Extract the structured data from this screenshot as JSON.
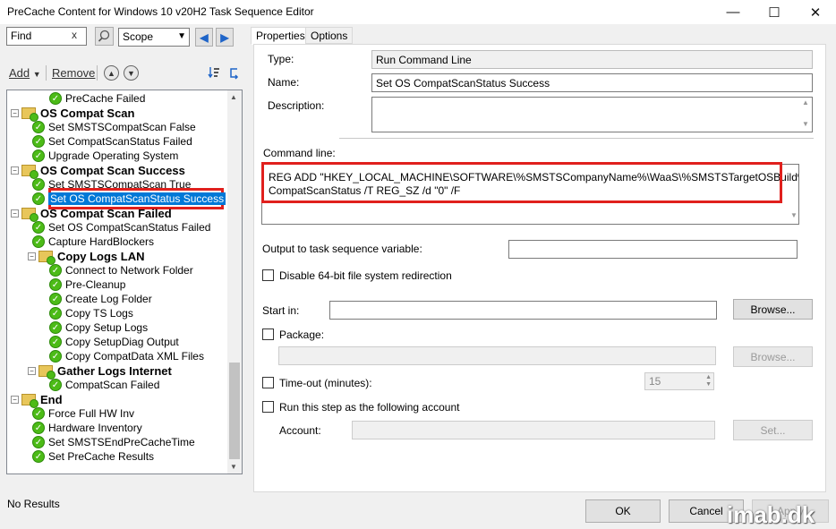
{
  "window": {
    "title": "PreCache Content for Windows 10 v20H2 Task Sequence Editor",
    "minimize_glyph": "—",
    "maximize_glyph": "☐",
    "close_glyph": "✕"
  },
  "toolbar": {
    "find_value": "Find",
    "find_clear": "x",
    "scope_value": "Scope",
    "add_label": "Add",
    "remove_label": "Remove",
    "icons": [
      "search-icon",
      "arrow-left-icon",
      "arrow-right-icon",
      "move-up-icon",
      "move-down-icon",
      "sort-icon",
      "refresh-icon"
    ]
  },
  "tree": {
    "items": [
      {
        "label": "PreCache Failed",
        "type": "step"
      },
      {
        "label": "OS Compat Scan",
        "type": "group"
      },
      {
        "label": "Set SMSTSCompatScan False",
        "type": "step"
      },
      {
        "label": "Set CompatScanStatus Failed",
        "type": "step"
      },
      {
        "label": "Upgrade Operating System",
        "type": "step"
      },
      {
        "label": "OS Compat Scan Success",
        "type": "group"
      },
      {
        "label": "Set SMSTSCompatScan True",
        "type": "step"
      },
      {
        "label": "Set OS CompatScanStatus Success",
        "type": "step",
        "selected": true
      },
      {
        "label": "OS Compat Scan Failed",
        "type": "group"
      },
      {
        "label": "Set OS CompatScanStatus Failed",
        "type": "step"
      },
      {
        "label": "Capture HardBlockers",
        "type": "step"
      },
      {
        "label": "Copy Logs LAN",
        "type": "group"
      },
      {
        "label": "Connect to Network Folder",
        "type": "step"
      },
      {
        "label": "Pre-Cleanup",
        "type": "step"
      },
      {
        "label": "Create Log Folder",
        "type": "step"
      },
      {
        "label": "Copy TS Logs",
        "type": "step"
      },
      {
        "label": "Copy Setup Logs",
        "type": "step"
      },
      {
        "label": "Copy SetupDiag Output",
        "type": "step"
      },
      {
        "label": "Copy CompatData XML Files",
        "type": "step"
      },
      {
        "label": "Gather Logs Internet",
        "type": "group"
      },
      {
        "label": "CompatScan Failed",
        "type": "step"
      },
      {
        "label": "End",
        "type": "group"
      },
      {
        "label": "Force Full HW Inv",
        "type": "step"
      },
      {
        "label": "Hardware Inventory",
        "type": "step"
      },
      {
        "label": "Set SMSTSEndPreCacheTime",
        "type": "step"
      },
      {
        "label": "Set PreCache Results",
        "type": "step"
      }
    ]
  },
  "status_text": "No Results",
  "tabs": [
    {
      "label": "Properties",
      "active": true
    },
    {
      "label": "Options",
      "active": false
    }
  ],
  "properties": {
    "type_label": "Type:",
    "type_value": "Run Command Line",
    "name_label": "Name:",
    "name_value": "Set OS CompatScanStatus Success",
    "description_label": "Description:",
    "description_value": "",
    "command_line_label": "Command line:",
    "command_line_1": "REG ADD \"HKEY_LOCAL_MACHINE\\SOFTWARE\\%SMSTSCompanyName%\\WaaS\\%SMSTSTargetOSBuild%\" /V",
    "command_line_2": "CompatScanStatus /T REG_SZ /d \"0\" /F",
    "output_var_label": "Output to task sequence variable:",
    "output_var_value": "",
    "disable64_label": "Disable 64-bit file system redirection",
    "start_in_label": "Start in:",
    "start_in_value": "",
    "browse_label": "Browse...",
    "package_label": "Package:",
    "package_value": "",
    "browse_disabled_label": "Browse...",
    "timeout_label": "Time-out (minutes):",
    "timeout_value": "15",
    "run_as_label": "Run this step as the following account",
    "account_label": "Account:",
    "account_value": "",
    "set_label": "Set..."
  },
  "footer": {
    "ok_label": "OK",
    "cancel_label": "Cancel",
    "apply_label": "Apply"
  },
  "watermark": "imab.dk"
}
